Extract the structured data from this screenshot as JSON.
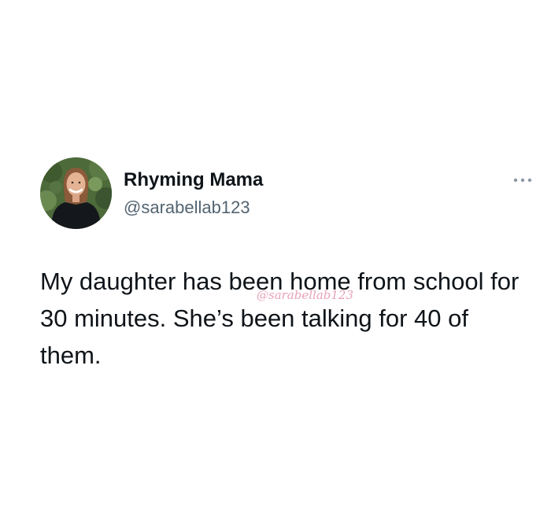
{
  "author": {
    "display_name": "Rhyming Mama",
    "handle": "@sarabellab123",
    "avatar_icon": "profile-photo"
  },
  "menu": {
    "icon": "more-horizontal-icon"
  },
  "tweet": {
    "text": "My daughter has been home from school for 30 minutes. She’s been talking for 40 of them."
  },
  "watermark": {
    "text": "@sarabellab123"
  },
  "colors": {
    "background": "#ffffff",
    "text_primary": "#0f1419",
    "text_secondary": "#536471",
    "watermark": "#e9a2b8"
  }
}
